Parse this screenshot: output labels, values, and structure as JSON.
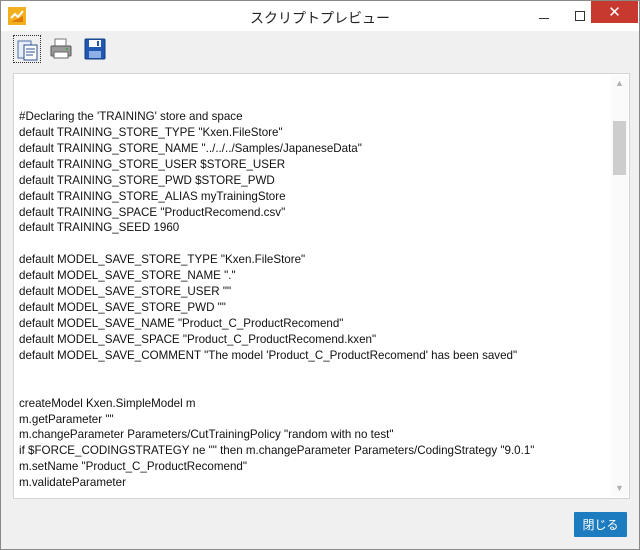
{
  "window": {
    "title": "スクリプトプレビュー",
    "close_glyph": "✕",
    "accent_color": "#c7392f"
  },
  "toolbar": {
    "icons": [
      "copy-icon",
      "print-icon",
      "save-icon"
    ]
  },
  "script": {
    "lines": [
      "#Declaring the 'TRAINING' store and space",
      "default TRAINING_STORE_TYPE \"Kxen.FileStore\"",
      "default TRAINING_STORE_NAME \"../../../Samples/JapaneseData\"",
      "default TRAINING_STORE_USER $STORE_USER",
      "default TRAINING_STORE_PWD $STORE_PWD",
      "default TRAINING_STORE_ALIAS myTrainingStore",
      "default TRAINING_SPACE \"ProductRecomend.csv\"",
      "default TRAINING_SEED 1960",
      "",
      "default MODEL_SAVE_STORE_TYPE \"Kxen.FileStore\"",
      "default MODEL_SAVE_STORE_NAME \".\"",
      "default MODEL_SAVE_STORE_USER \"\"",
      "default MODEL_SAVE_STORE_PWD \"\"",
      "default MODEL_SAVE_NAME \"Product_C_ProductRecomend\"",
      "default MODEL_SAVE_SPACE \"Product_C_ProductRecomend.kxen\"",
      "default MODEL_SAVE_COMMENT \"The model 'Product_C_ProductRecomend' has been saved\"",
      "",
      "",
      "createModel Kxen.SimpleModel m",
      "m.getParameter \"\"",
      "m.changeParameter Parameters/CutTrainingPolicy \"random with no test\"",
      "if $FORCE_CODINGSTRATEGY ne \"\" then m.changeParameter Parameters/CodingStrategy \"9.0.1\"",
      "m.setName \"Product_C_ProductRecomend\"",
      "m.validateParameter"
    ]
  },
  "footer": {
    "close_label": "閉じる",
    "close_color": "#1d7cc0"
  }
}
